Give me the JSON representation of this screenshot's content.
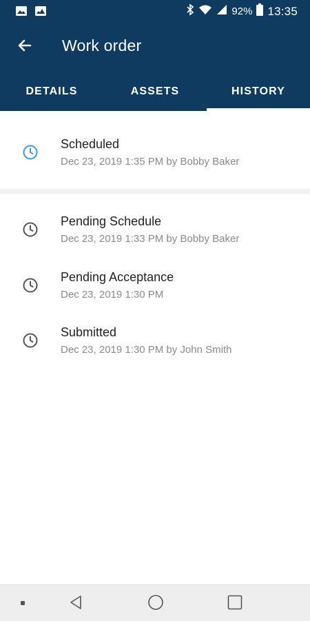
{
  "status_bar": {
    "time": "13:35",
    "battery_percent": "92%",
    "icons": [
      "image-icon",
      "photo-icon",
      "bluetooth-icon",
      "wifi-icon",
      "signal-icon",
      "battery-icon"
    ]
  },
  "app_bar": {
    "title": "Work order",
    "back_icon": "back-arrow-icon"
  },
  "tabs": [
    {
      "label": "DETAILS",
      "selected": false
    },
    {
      "label": "ASSETS",
      "selected": false
    },
    {
      "label": "HISTORY",
      "selected": true
    }
  ],
  "current_status": {
    "title": "Scheduled",
    "subtitle": "Dec 23, 2019 1:35 PM by Bobby Baker",
    "icon": "clock-icon",
    "icon_color": "#3a9bd9"
  },
  "history": [
    {
      "title": "Pending Schedule",
      "subtitle": "Dec 23, 2019 1:33 PM by Bobby Baker",
      "icon": "clock-icon"
    },
    {
      "title": "Pending Acceptance",
      "subtitle": "Dec 23, 2019 1:30 PM",
      "icon": "clock-icon"
    },
    {
      "title": "Submitted",
      "subtitle": "Dec 23, 2019 1:30 PM by John Smith",
      "icon": "clock-icon"
    }
  ],
  "nav_bar": {
    "icons": [
      "menu-dot-icon",
      "back-triangle-icon",
      "home-circle-icon",
      "recents-square-icon"
    ]
  },
  "colors": {
    "header": "#0f3b61",
    "accent": "#3a9bd9",
    "icon_gray": "#555555",
    "subtitle": "#8a8a8a"
  }
}
